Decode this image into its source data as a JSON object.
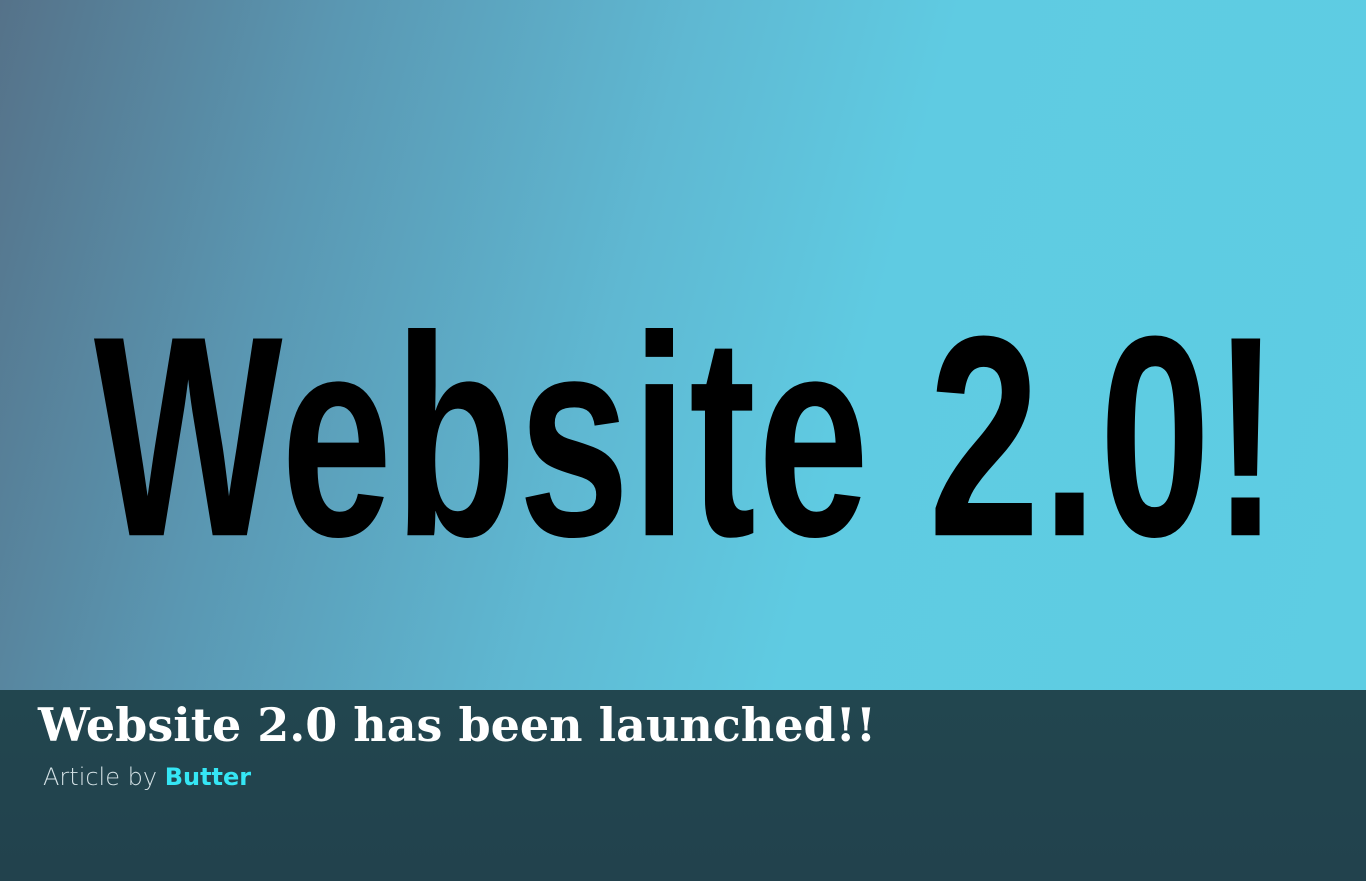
{
  "hero": {
    "image_text": "Website 2.0!"
  },
  "article": {
    "title": "Website 2.0 has been launched!!",
    "byline_prefix": "Article by",
    "author": "Butter"
  },
  "colors": {
    "caption_background": "#22464f",
    "author_link": "#35e6f5",
    "hero_gradient_start": "#557289",
    "hero_gradient_end": "#5ecde3"
  }
}
